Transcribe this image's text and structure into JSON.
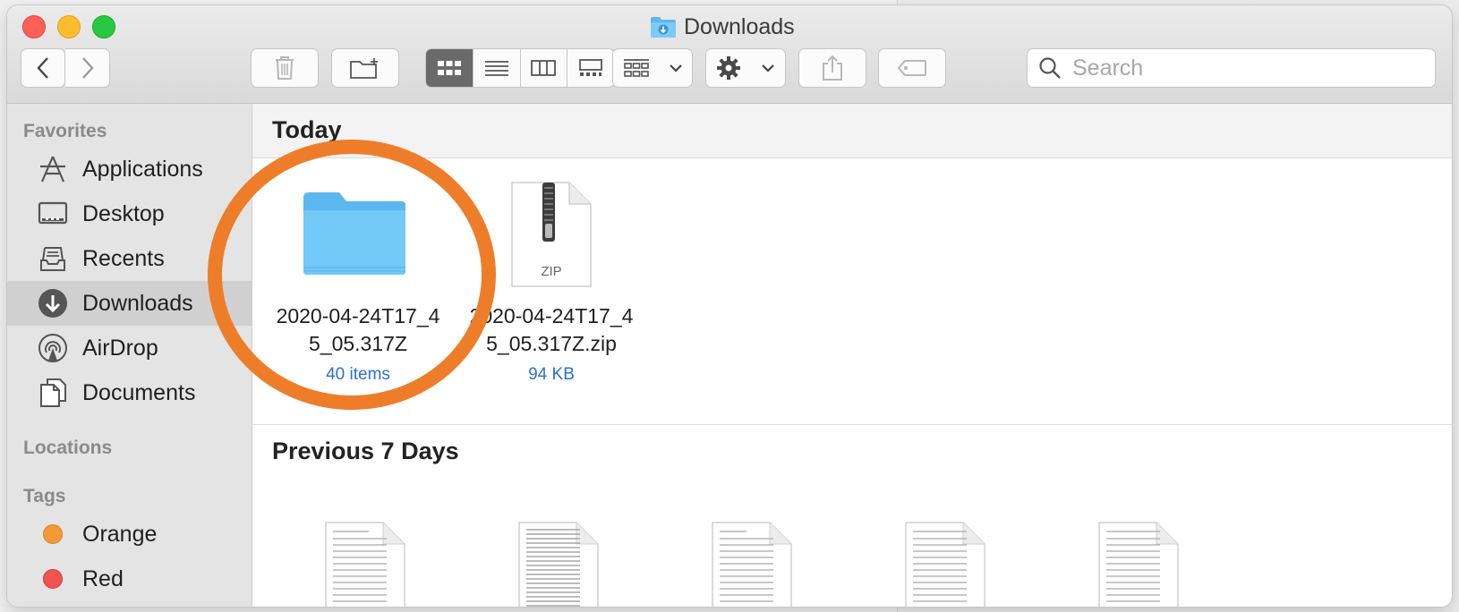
{
  "window": {
    "title": "Downloads"
  },
  "toolbar": {
    "search_placeholder": "Search"
  },
  "sidebar": {
    "favorites_label": "Favorites",
    "items": [
      {
        "label": "Applications",
        "icon": "applications-icon"
      },
      {
        "label": "Desktop",
        "icon": "desktop-icon"
      },
      {
        "label": "Recents",
        "icon": "recents-icon"
      },
      {
        "label": "Downloads",
        "icon": "downloads-icon",
        "selected": true
      },
      {
        "label": "AirDrop",
        "icon": "airdrop-icon"
      },
      {
        "label": "Documents",
        "icon": "documents-icon"
      }
    ],
    "locations_label": "Locations",
    "tags_label": "Tags",
    "tags": [
      {
        "label": "Orange",
        "color": "#f39a36"
      },
      {
        "label": "Red",
        "color": "#f0534f"
      }
    ]
  },
  "content": {
    "groups": [
      {
        "title": "Today",
        "files": [
          {
            "name_line1": "2020-04-24T17_4",
            "name_line2": "5_05.317Z",
            "meta": "40 items",
            "kind": "folder"
          },
          {
            "name_line1": "2020-04-24T17_4",
            "name_line2": "5_05.317Z.zip",
            "meta": "94 KB",
            "kind": "zip",
            "badge": "ZIP"
          }
        ]
      },
      {
        "title": "Previous 7 Days"
      }
    ]
  },
  "colors": {
    "accent_circle": "#ee7d2a",
    "folder_blue": "#6cc4f5",
    "meta_blue": "#2f6fd0"
  }
}
